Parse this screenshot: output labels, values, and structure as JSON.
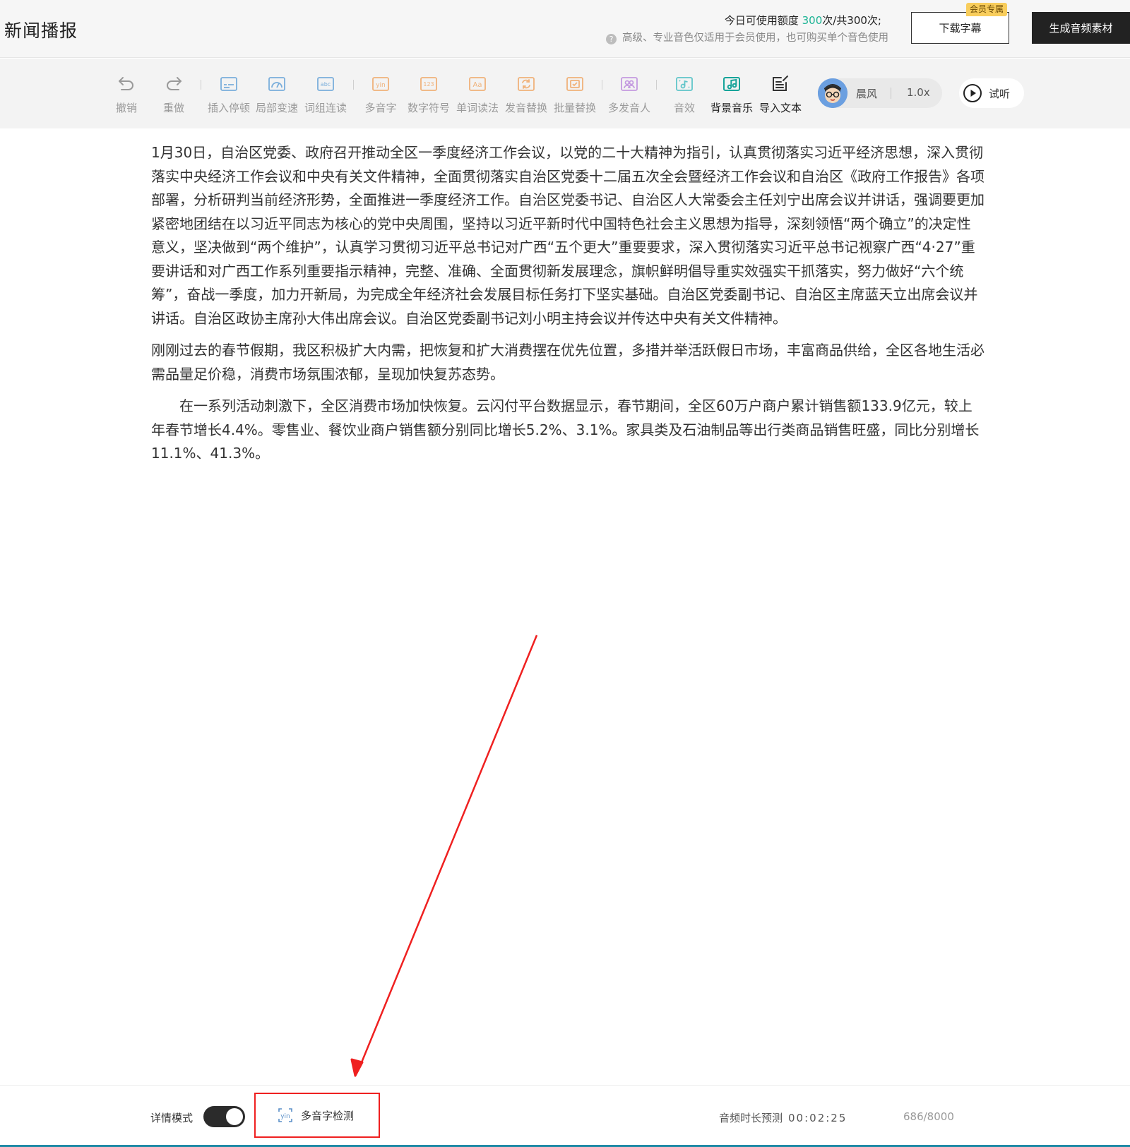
{
  "header": {
    "title": "新闻播报",
    "quota_prefix": "今日可使用额度 ",
    "quota_used": "300",
    "quota_suffix": "次/共300次;",
    "tip": "高级、专业音色仅适用于会员使用，也可购买单个音色使用",
    "download_label": "下载字幕",
    "vip_badge": "会员专属",
    "generate_label": "生成音频素材"
  },
  "toolbar": {
    "tools": [
      {
        "label": "撤销",
        "icon": "undo-icon"
      },
      {
        "label": "重做",
        "icon": "redo-icon"
      },
      {
        "label": "插入停顿",
        "icon": "insert-pause-icon"
      },
      {
        "label": "局部变速",
        "icon": "speed-gauge-icon"
      },
      {
        "label": "词组连读",
        "icon": "abc-icon"
      },
      {
        "label": "多音字",
        "icon": "yin-icon"
      },
      {
        "label": "数字符号",
        "icon": "number-123-icon"
      },
      {
        "label": "单词读法",
        "icon": "aa-icon"
      },
      {
        "label": "发音替换",
        "icon": "replace-icon"
      },
      {
        "label": "批量替换",
        "icon": "batch-replace-icon"
      },
      {
        "label": "多发音人",
        "icon": "multi-speaker-icon"
      },
      {
        "label": "音效",
        "icon": "sound-effect-icon"
      },
      {
        "label": "背景音乐",
        "icon": "music-note-icon"
      },
      {
        "label": "导入文本",
        "icon": "import-text-icon"
      }
    ],
    "voice_name": "晨风",
    "voice_speed": "1.0x",
    "listen_label": "试听"
  },
  "editor": {
    "paragraphs": [
      "1月30日，自治区党委、政府召开推动全区一季度经济工作会议，以党的二十大精神为指引，认真贯彻落实习近平经济思想，深入贯彻落实中央经济工作会议和中央有关文件精神，全面贯彻落实自治区党委十二届五次全会暨经济工作会议和自治区《政府工作报告》各项部署，分析研判当前经济形势，全面推进一季度经济工作。自治区党委书记、自治区人大常委会主任刘宁出席会议并讲话，强调要更加紧密地团结在以习近平同志为核心的党中央周围，坚持以习近平新时代中国特色社会主义思想为指导，深刻领悟“两个确立”的决定性意义，坚决做到“两个维护”，认真学习贯彻习近平总书记对广西“五个更大”重要要求，深入贯彻落实习近平总书记视察广西“4·27”重要讲话和对广西工作系列重要指示精神，完整、准确、全面贯彻新发展理念，旗帜鲜明倡导重实效强实干抓落实，努力做好“六个统筹”，奋战一季度，加力开新局，为完成全年经济社会发展目标任务打下坚实基础。自治区党委副书记、自治区主席蓝天立出席会议并讲话。自治区政协主席孙大伟出席会议。自治区党委副书记刘小明主持会议并传达中央有关文件精神。",
      "刚刚过去的春节假期，我区积极扩大内需，把恢复和扩大消费摆在优先位置，多措并举活跃假日市场，丰富商品供给，全区各地生活必需品量足价稳，消费市场氛围浓郁，呈现加快复苏态势。",
      "在一系列活动刺激下，全区消费市场加快恢复。云闪付平台数据显示，春节期间，全区60万户商户累计销售额133.9亿元，较上年春节增长4.4%。零售业、餐饮业商户销售额分别同比增长5.2%、3.1%。家具类及石油制品等出行类商品销售旺盛，同比分别增长11.1%、41.3%。"
    ]
  },
  "footer": {
    "detail_mode_label": "详情模式",
    "poly_check_label": "多音字检测",
    "duration_label": "音频时长预测",
    "duration_value": "00:02:25",
    "char_count": "686/8000"
  },
  "colors": {
    "accent_green": "#1bb394",
    "annotation_red": "#ef2020",
    "vip_gold": "#f8cd5c"
  }
}
